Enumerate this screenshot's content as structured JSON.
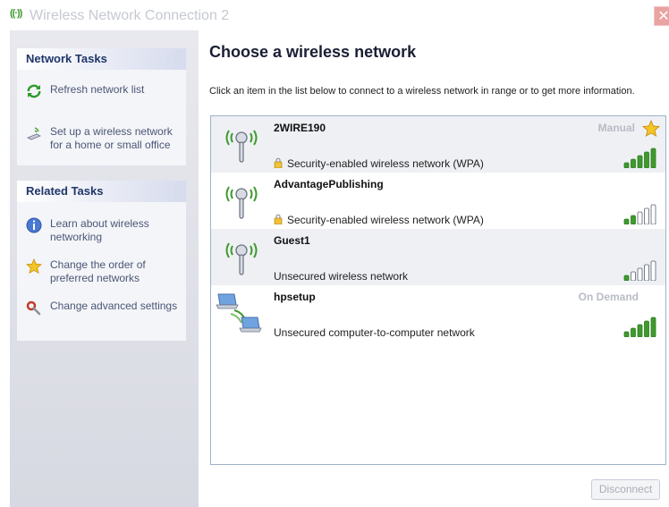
{
  "window": {
    "title": "Wireless Network Connection 2",
    "close_symbol": "✕"
  },
  "sidebar": {
    "network_tasks": {
      "heading": "Network Tasks",
      "items": [
        {
          "label": "Refresh network list",
          "icon": "refresh-icon"
        },
        {
          "label": "Set up a wireless network for a home or small office",
          "icon": "setup-wireless-icon"
        }
      ]
    },
    "related_tasks": {
      "heading": "Related Tasks",
      "items": [
        {
          "label": "Learn about wireless networking",
          "icon": "info-icon"
        },
        {
          "label": "Change the order of preferred networks",
          "icon": "star-icon"
        },
        {
          "label": "Change advanced settings",
          "icon": "settings-icon"
        }
      ]
    }
  },
  "main": {
    "title": "Choose a wireless network",
    "description": "Click an item in the list below to connect to a wireless network in range or to get more information.",
    "networks": [
      {
        "name": "2WIRE190",
        "status": "Security-enabled wireless network (WPA)",
        "tag": "Manual",
        "secured": true,
        "signal_bars": 5,
        "type": "access-point"
      },
      {
        "name": "AdvantagePublishing",
        "status": "Security-enabled wireless network (WPA)",
        "tag": "",
        "secured": true,
        "signal_bars": 2,
        "type": "access-point"
      },
      {
        "name": "Guest1",
        "status": "Unsecured wireless network",
        "tag": "",
        "secured": false,
        "signal_bars": 1,
        "type": "access-point"
      },
      {
        "name": "hpsetup",
        "status": "Unsecured computer-to-computer network",
        "tag": "On Demand",
        "secured": false,
        "signal_bars": 5,
        "type": "ad-hoc"
      }
    ],
    "disconnect_label": "Disconnect"
  },
  "colors": {
    "signal_on": "#3f9a2e",
    "signal_off": "#ffffff",
    "panel_heading": "#20356a",
    "list_border": "#9fb2c8"
  }
}
